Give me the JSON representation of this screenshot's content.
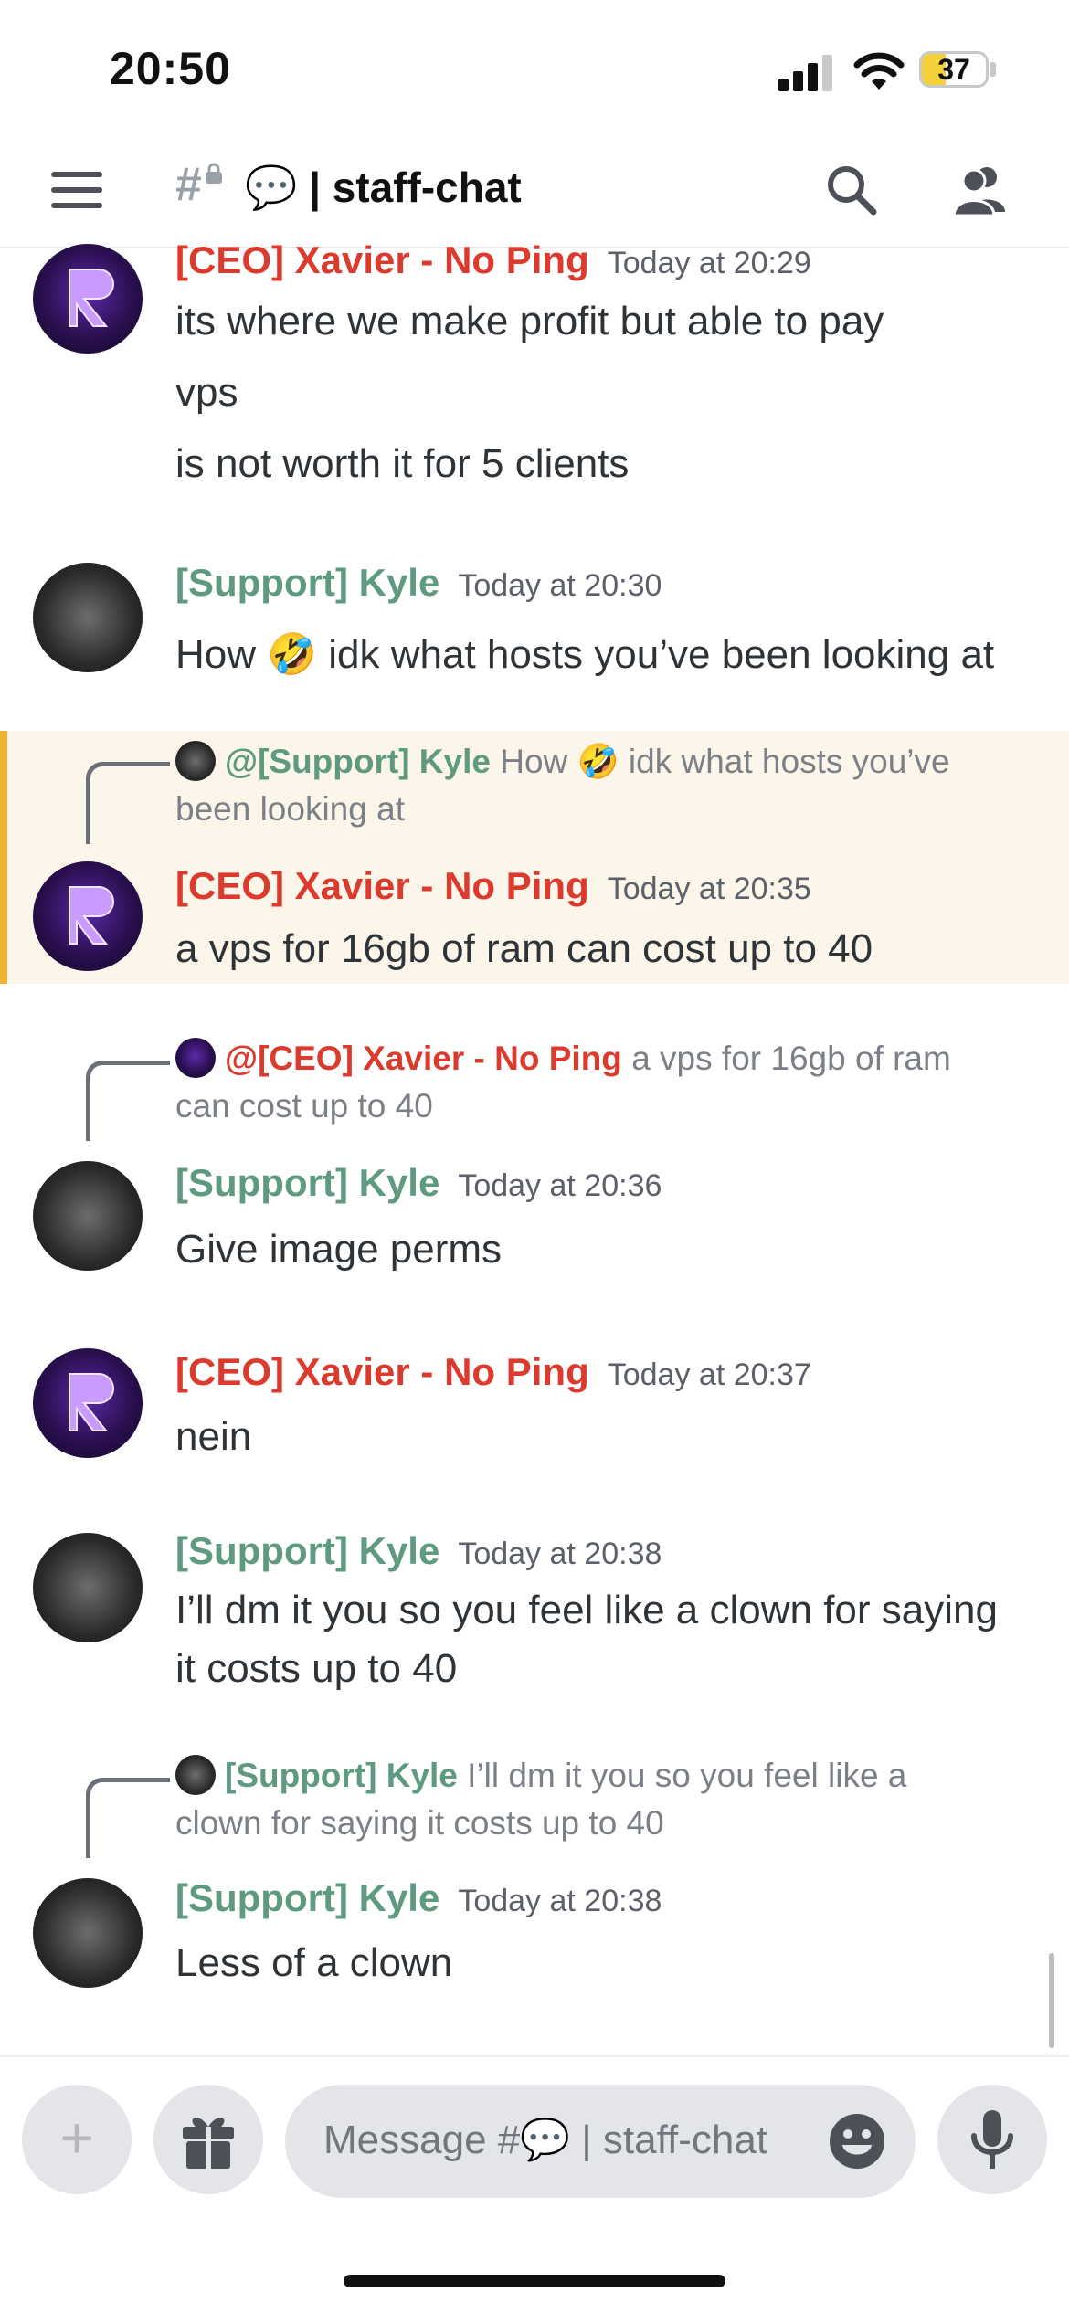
{
  "status_bar": {
    "time": "20:50",
    "battery": "37",
    "battery_level": 0.37
  },
  "header": {
    "channel_hash": "#",
    "channel_emoji": "💬",
    "channel_name": "| staff-chat",
    "menu_icon": "hamburger-menu-icon",
    "search_icon": "search-icon",
    "members_icon": "members-icon"
  },
  "colors": {
    "ceo_role": "#dc3a2d",
    "support_role": "#5e9a80",
    "highlight_bg": "#fbf6e9",
    "highlight_bar": "#f0b232"
  },
  "messages": [
    {
      "author": "[CEO] Xavier - No Ping",
      "timestamp": "Today at 20:29",
      "lines": [
        "its where we make profit but able to pay",
        "vps",
        "is not worth it for 5 clients"
      ]
    },
    {
      "author": "[Support] Kyle",
      "timestamp": "Today at 20:30",
      "lines": [
        "How 🤣 idk what hosts you’ve been looking at"
      ]
    },
    {
      "reply": {
        "author": "@[Support] Kyle",
        "text_line1": "How 🤣 idk what hosts you’ve",
        "text_line2": "been looking at"
      },
      "author": "[CEO] Xavier - No Ping",
      "timestamp": "Today at 20:35",
      "lines": [
        "a vps for 16gb of ram can cost up to 40"
      ]
    },
    {
      "reply": {
        "author": "@[CEO] Xavier - No Ping",
        "text_line1": "a vps for 16gb of ram",
        "text_line2": "can cost up to 40"
      },
      "author": "[Support] Kyle",
      "timestamp": "Today at 20:36",
      "lines": [
        "Give image perms"
      ]
    },
    {
      "author": "[CEO] Xavier - No Ping",
      "timestamp": "Today at 20:37",
      "lines": [
        "nein"
      ]
    },
    {
      "author": "[Support] Kyle",
      "timestamp": "Today at 20:38",
      "lines": [
        "I’ll dm it you so you feel like a clown for saying",
        "it costs up to 40"
      ]
    },
    {
      "reply": {
        "author": "[Support] Kyle",
        "text_line1": "I’ll dm it you so you feel like a",
        "text_line2": "clown for saying it costs up to 40"
      },
      "author": "[Support] Kyle",
      "timestamp": "Today at 20:38",
      "lines": [
        "Less of a clown"
      ]
    }
  ],
  "composer": {
    "placeholder": "Message #💬 | staff-chat",
    "add_icon": "plus-icon",
    "gift_icon": "gift-icon",
    "emoji_icon": "emoji-icon",
    "mic_icon": "microphone-icon"
  }
}
